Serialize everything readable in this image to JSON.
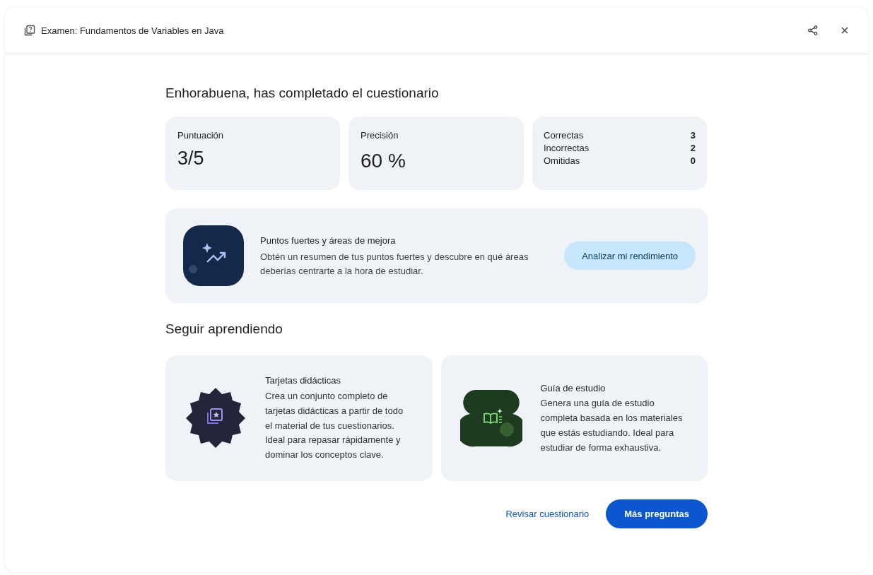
{
  "window": {
    "title": "Examen: Fundamentos de Variables en Java"
  },
  "heading": "Enhorabuena, has completado el cuestionario",
  "score": {
    "label": "Puntuación",
    "value": "3/5"
  },
  "accuracy": {
    "label": "Precisión",
    "value": "60 %"
  },
  "counts": [
    {
      "label": "Correctas",
      "value": "3"
    },
    {
      "label": "Incorrectas",
      "value": "2"
    },
    {
      "label": "Omitidas",
      "value": "0"
    }
  ],
  "insight": {
    "title": "Puntos fuertes y áreas de mejora",
    "text": "Obtén un resumen de tus puntos fuertes y descubre en qué áreas deberías centrarte a la hora de estudiar.",
    "button": "Analizar mi rendimiento"
  },
  "section_title": "Seguir aprendiendo",
  "tiles": [
    {
      "kind": "flashcards",
      "title": "Tarjetas didácticas",
      "text": "Crea un conjunto completo de tarjetas didácticas a partir de todo el material de tus cuestionarios. Ideal para repasar rápidamente y dominar los conceptos clave."
    },
    {
      "kind": "guide",
      "title": "Guía de estudio",
      "text": "Genera una guía de estudio completa basada en los materiales que estás estudiando. Ideal para estudiar de forma exhaustiva."
    }
  ],
  "actions": {
    "secondary": "Revisar cuestionario",
    "primary": "Más preguntas"
  }
}
